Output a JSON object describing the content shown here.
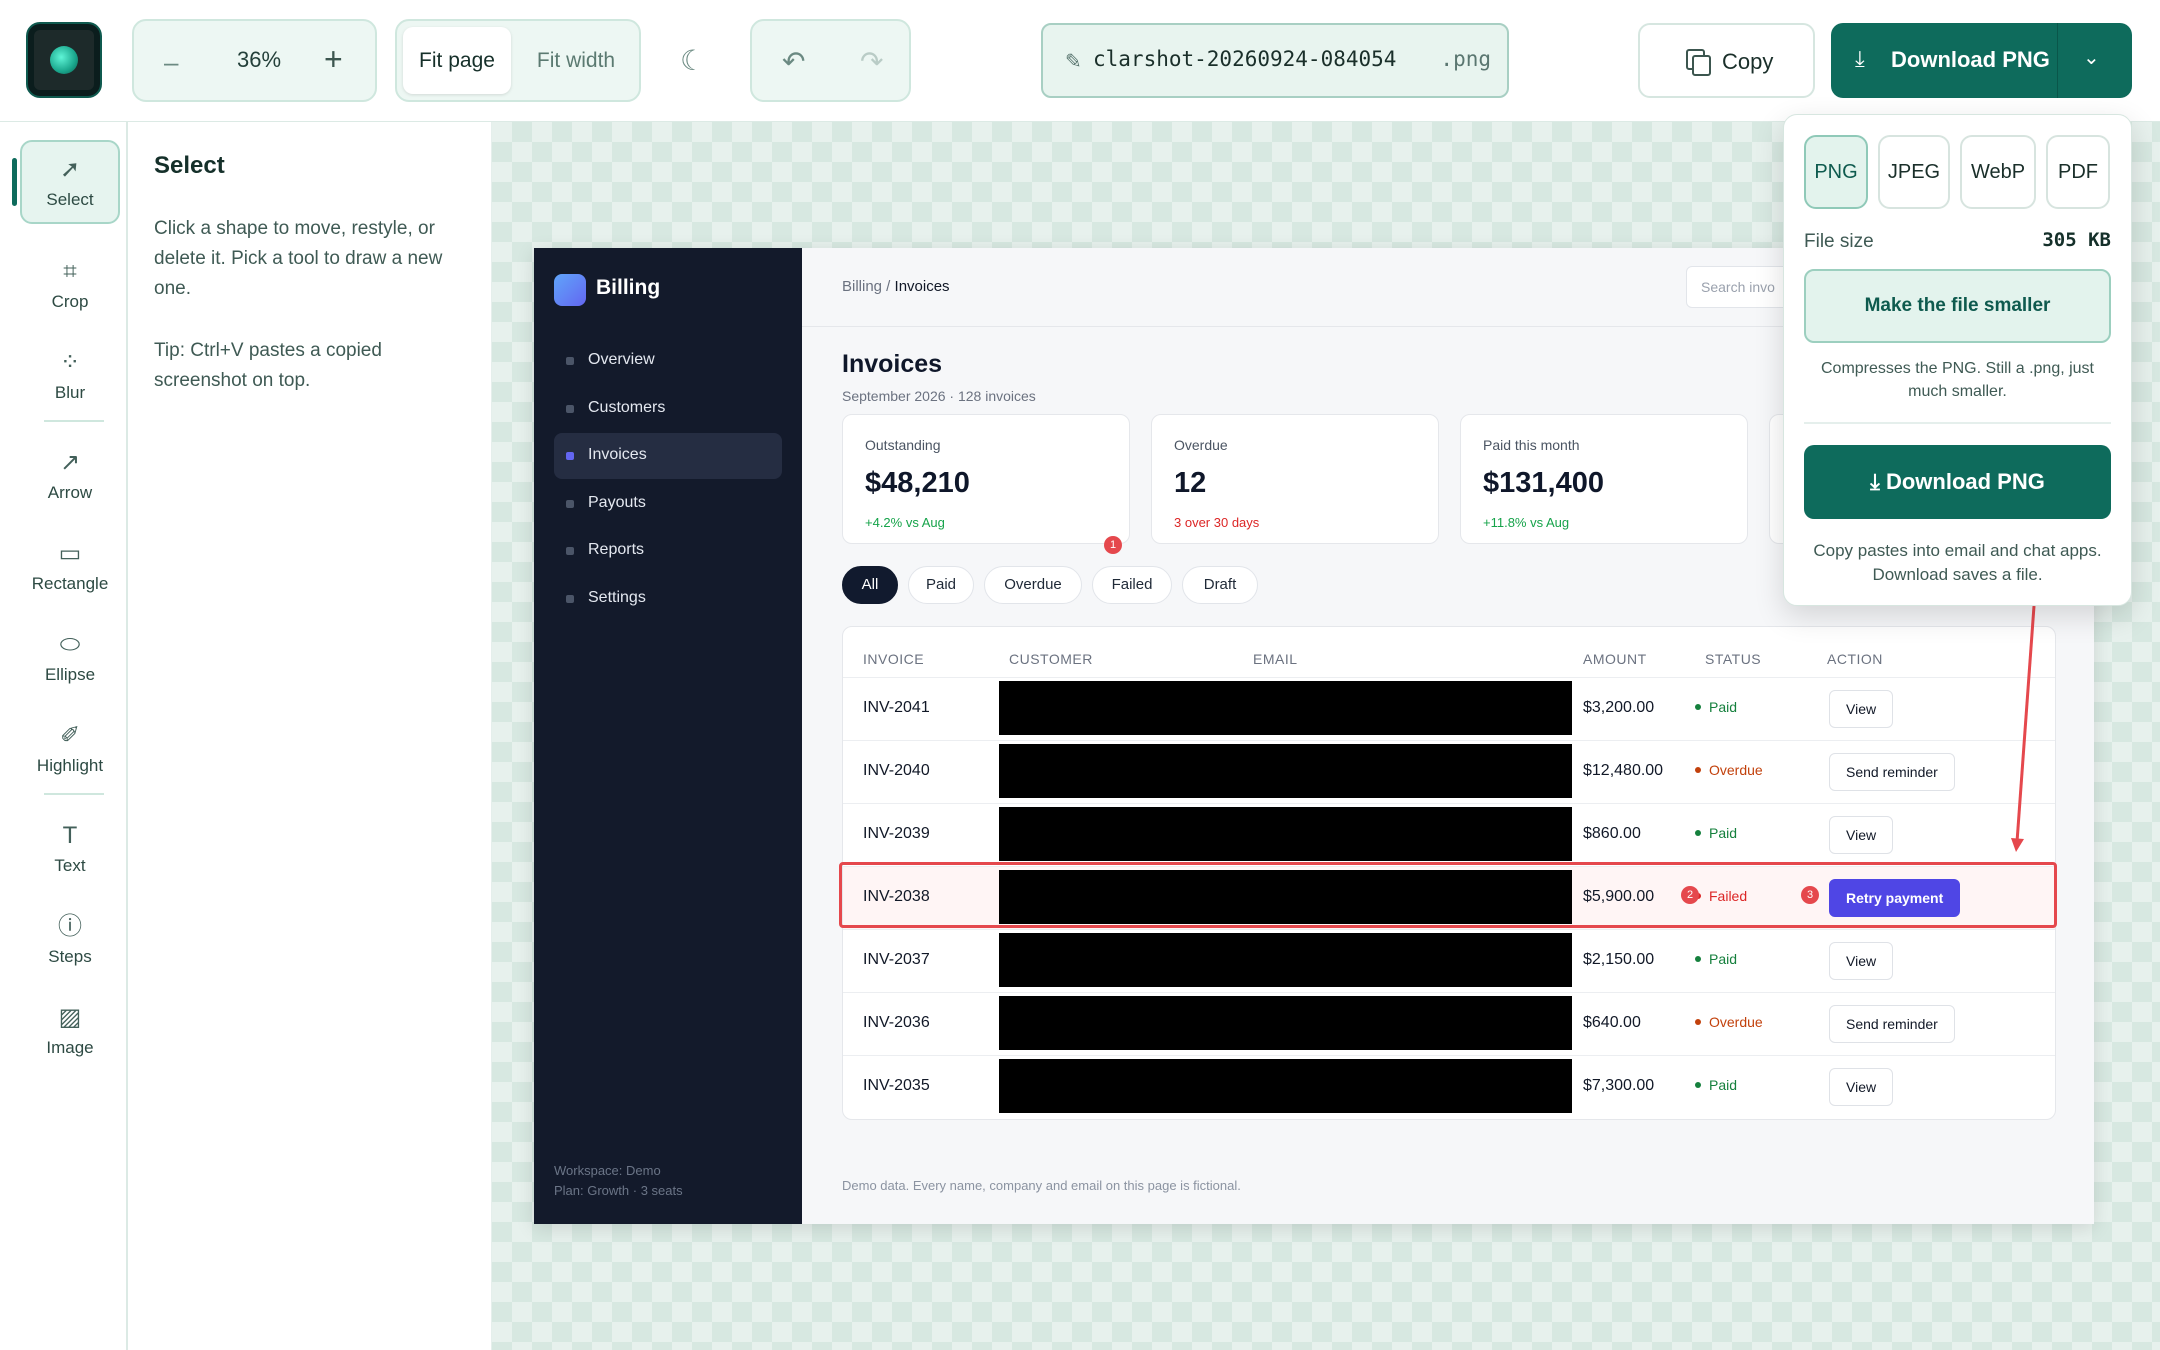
{
  "toolbar": {
    "zoom_minus": "–",
    "zoom_value": "36%",
    "zoom_plus": "+",
    "fit_page": "Fit page",
    "fit_width": "Fit width",
    "filename": "clarshot-20260924-084054",
    "extension": ".png",
    "copy_label": "Copy",
    "download_label": "Download PNG"
  },
  "tools": [
    {
      "label": "Select",
      "icon": "cursor-icon"
    },
    {
      "label": "Crop",
      "icon": "crop-icon"
    },
    {
      "label": "Blur",
      "icon": "blur-icon"
    },
    {
      "label": "Arrow",
      "icon": "arrow-icon"
    },
    {
      "label": "Rectangle",
      "icon": "rectangle-icon"
    },
    {
      "label": "Ellipse",
      "icon": "ellipse-icon"
    },
    {
      "label": "Highlight",
      "icon": "highlight-icon"
    },
    {
      "label": "Text",
      "icon": "text-icon"
    },
    {
      "label": "Steps",
      "icon": "steps-icon"
    },
    {
      "label": "Image",
      "icon": "image-icon"
    }
  ],
  "inspector": {
    "title": "Select",
    "body": "Click a shape to move, restyle, or delete it. Pick a tool to draw a new one.",
    "tip": "Tip: Ctrl+V pastes a copied screenshot on top."
  },
  "screenshot": {
    "brand": "Billing",
    "nav": [
      "Overview",
      "Customers",
      "Invoices",
      "Payouts",
      "Reports",
      "Settings"
    ],
    "active_nav": "Invoices",
    "workspace": "Workspace: Demo",
    "plan": "Plan: Growth · 3 seats",
    "breadcrumb_root": "Billing /",
    "breadcrumb_current": "Invoices",
    "search_placeholder": "Search invo",
    "title": "Invoices",
    "subtitle": "September 2026 · 128 invoices",
    "cards": [
      {
        "label": "Outstanding",
        "value": "$48,210",
        "delta": "+4.2% vs Aug",
        "color": "#16a34a"
      },
      {
        "label": "Overdue",
        "value": "12",
        "delta": "3 over 30 days",
        "color": "#dc2626"
      },
      {
        "label": "Paid this month",
        "value": "$131,400",
        "delta": "+11.8% vs Aug",
        "color": "#16a34a"
      }
    ],
    "filters": [
      "All",
      "Paid",
      "Overdue",
      "Failed",
      "Draft"
    ],
    "columns": [
      "INVOICE",
      "CUSTOMER",
      "EMAIL",
      "AMOUNT",
      "STATUS",
      "ACTION"
    ],
    "rows": [
      {
        "id": "INV-2041",
        "amount": "$3,200.00",
        "status": "Paid",
        "action": "View"
      },
      {
        "id": "INV-2040",
        "amount": "$12,480.00",
        "status": "Overdue",
        "action": "Send reminder"
      },
      {
        "id": "INV-2039",
        "amount": "$860.00",
        "status": "Paid",
        "action": "View"
      },
      {
        "id": "INV-2038",
        "amount": "$5,900.00",
        "status": "Failed",
        "action": "Retry payment"
      },
      {
        "id": "INV-2037",
        "amount": "$2,150.00",
        "status": "Paid",
        "action": "View"
      },
      {
        "id": "INV-2036",
        "amount": "$640.00",
        "status": "Overdue",
        "action": "Send reminder"
      },
      {
        "id": "INV-2035",
        "amount": "$7,300.00",
        "status": "Paid",
        "action": "View"
      }
    ],
    "status_colors": {
      "Paid": "#15803d",
      "Overdue": "#c2410c",
      "Failed": "#dc2626"
    },
    "footer": "Demo data. Every name, company and email on this page is fictional.",
    "step_badges": [
      "1",
      "2",
      "3"
    ]
  },
  "export_popover": {
    "formats": [
      "PNG",
      "JPEG",
      "WebP",
      "PDF"
    ],
    "selected_format": "PNG",
    "file_size_label": "File size",
    "file_size_value": "305 KB",
    "smaller_button": "Make the file smaller",
    "compress_note": "Compresses the PNG. Still a .png, just much smaller.",
    "download_button": "Download PNG",
    "hint": "Copy pastes into email and chat apps. Download saves a file."
  },
  "colors": {
    "accent": "#0e6b5c",
    "highlight_red": "#e5484d",
    "retry_button": "#4f46e5"
  }
}
